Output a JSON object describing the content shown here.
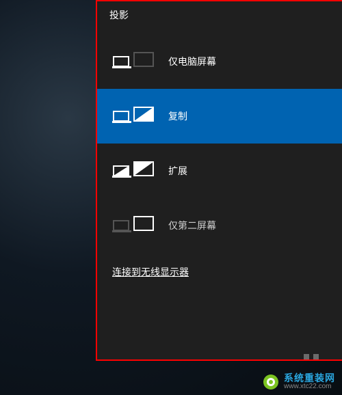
{
  "panel": {
    "title": "投影",
    "options": [
      {
        "key": "pc-only",
        "label": "仅电脑屏幕",
        "selected": false
      },
      {
        "key": "duplicate",
        "label": "复制",
        "selected": true
      },
      {
        "key": "extend",
        "label": "扩展",
        "selected": false
      },
      {
        "key": "second-only",
        "label": "仅第二屏幕",
        "selected": false
      }
    ],
    "link": "连接到无线显示器"
  },
  "watermark": {
    "title": "系统重装网",
    "url": "www.xtc22.com"
  },
  "colors": {
    "selected_bg": "#0063b1",
    "panel_bg": "#1f1f1f",
    "highlight_border": "#ff0000"
  }
}
